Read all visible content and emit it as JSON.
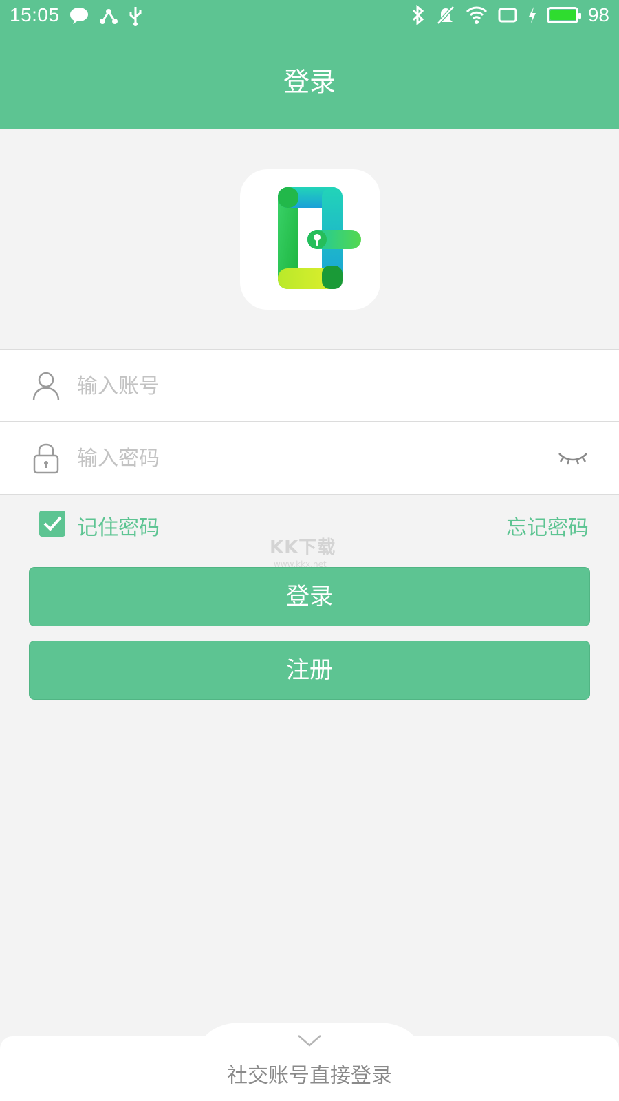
{
  "status_bar": {
    "time": "15:05",
    "battery": "98",
    "battery_level": 0.98,
    "left_icons": [
      "chat-icon",
      "share-icon",
      "usb-icon"
    ],
    "right_icons": [
      "bluetooth-icon",
      "mute-icon",
      "wifi-icon",
      "screen-icon",
      "charging-icon"
    ]
  },
  "header": {
    "title": "登录"
  },
  "form": {
    "account_placeholder": "输入账号",
    "password_placeholder": "输入密码",
    "remember_label": "记住密码",
    "remember_checked": true,
    "forgot_label": "忘记密码"
  },
  "watermark": {
    "text": "KK下载",
    "sub": "www.kkx.net"
  },
  "buttons": {
    "login": "登录",
    "register": "注册"
  },
  "social": {
    "label": "社交账号直接登录"
  },
  "colors": {
    "accent": "#5dc492",
    "background": "#f3f3f3",
    "placeholder": "#c3c3c3"
  }
}
